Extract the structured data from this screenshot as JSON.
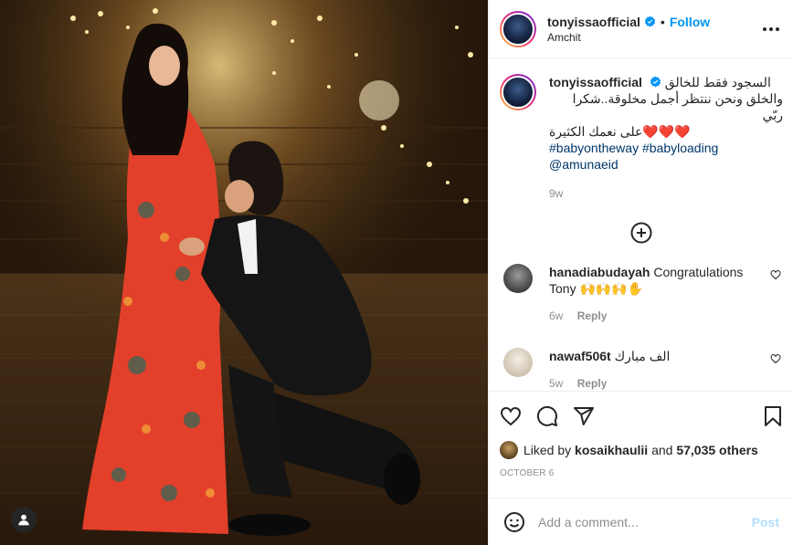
{
  "post": {
    "username": "tonyissaofficial",
    "dot": "•",
    "follow_label": "Follow",
    "location": "Amchit",
    "caption_arabic_1": "السجود فقط للخالق",
    "caption_arabic_2": "والخلق ونحن ننتظر أجمل مخلوقة..شكرا ربّي",
    "caption_arabic_3": "على نعمك الكثيرة",
    "caption_hearts": "❤️❤️❤️",
    "hashtag_1": "#babyontheway",
    "hashtag_2": "#babyloading",
    "mention": "@amunaeid",
    "caption_time": "9w"
  },
  "comments": [
    {
      "username": "hanadiabudayah",
      "text": "Congratulations Tony 🙌🙌🙌✋",
      "time": "6w",
      "reply_label": "Reply"
    },
    {
      "username": "nawaf506t",
      "text": "الف مبارك",
      "time": "5w",
      "reply_label": "Reply"
    }
  ],
  "likes": {
    "prefix": "Liked by",
    "user": "kosaikhaulii",
    "and": "and",
    "count": "57,035 others"
  },
  "date": "OCTOBER 6",
  "composer": {
    "placeholder": "Add a comment...",
    "post_label": "Post"
  },
  "icons": {
    "verified": "verified-badge-icon",
    "more": "more-options-icon",
    "load_more": "plus-circle-icon",
    "like": "heart-icon",
    "comment": "comment-icon",
    "share": "share-icon",
    "save": "bookmark-icon",
    "emoji": "emoji-icon",
    "tag": "user-tag-icon"
  },
  "colors": {
    "accent": "#0095f6",
    "post_disabled": "#b2dffc",
    "hashtag": "#00376b",
    "muted": "#8e8e8e"
  }
}
